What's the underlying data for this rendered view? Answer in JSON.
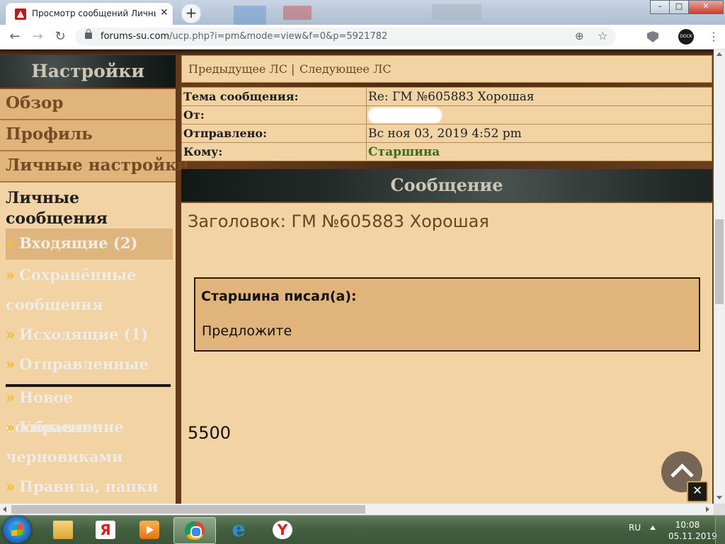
{
  "browser": {
    "tab_title": "Просмотр сообщений Личный",
    "tab_close": "✕",
    "new_tab": "+",
    "url_host": "forums-su.com",
    "url_path": "/ucp.php?i=pm&mode=view&f=0&p=5921782",
    "ext_label": "DOCK"
  },
  "sidebar": {
    "header": "Настройки",
    "tabs": [
      {
        "label": "Обзор"
      },
      {
        "label": "Профиль"
      },
      {
        "label": "Личные настройки"
      }
    ],
    "active_section": "Личные сообщения",
    "bullet": "»",
    "items": [
      {
        "label": "Входящие (2)",
        "selected": true
      },
      {
        "label": "Сохранённые сообщения"
      },
      {
        "label": "Исходящие (1)"
      },
      {
        "label": "Отправленные"
      },
      {
        "label": "Новое сообщение"
      },
      {
        "label": "Управление черновиками"
      },
      {
        "label": "Правила, папки"
      }
    ]
  },
  "pagination": {
    "prev": "Предыдущее ЛС",
    "separator": "|",
    "next": "Следующее ЛС"
  },
  "message_header": {
    "rows": [
      {
        "label": "Тема сообщения:",
        "value": "Re: ГМ №605883 Хорошая"
      },
      {
        "label": "От:",
        "value": ""
      },
      {
        "label": "Отправлено:",
        "value": "Вс ноя 03, 2019 4:52 pm"
      },
      {
        "label": "Кому:",
        "value": "Старшина"
      }
    ]
  },
  "message": {
    "section_title": "Сообщение",
    "subject_line": "Заголовок: ГМ №605883 Хорошая",
    "quote_author": "Старшина писал(а):",
    "quote_text": "Предложите",
    "body": "5500"
  },
  "taskbar": {
    "language": "RU",
    "time": "10:08",
    "date": "05.11.2019"
  },
  "colors": {
    "panel_bg": "#f2d3a4",
    "tab_bg": "#e0b47b",
    "brown_text": "#6b4422",
    "recipient_green": "#3e6b1e",
    "bullet_yellow": "#f4c02a"
  }
}
